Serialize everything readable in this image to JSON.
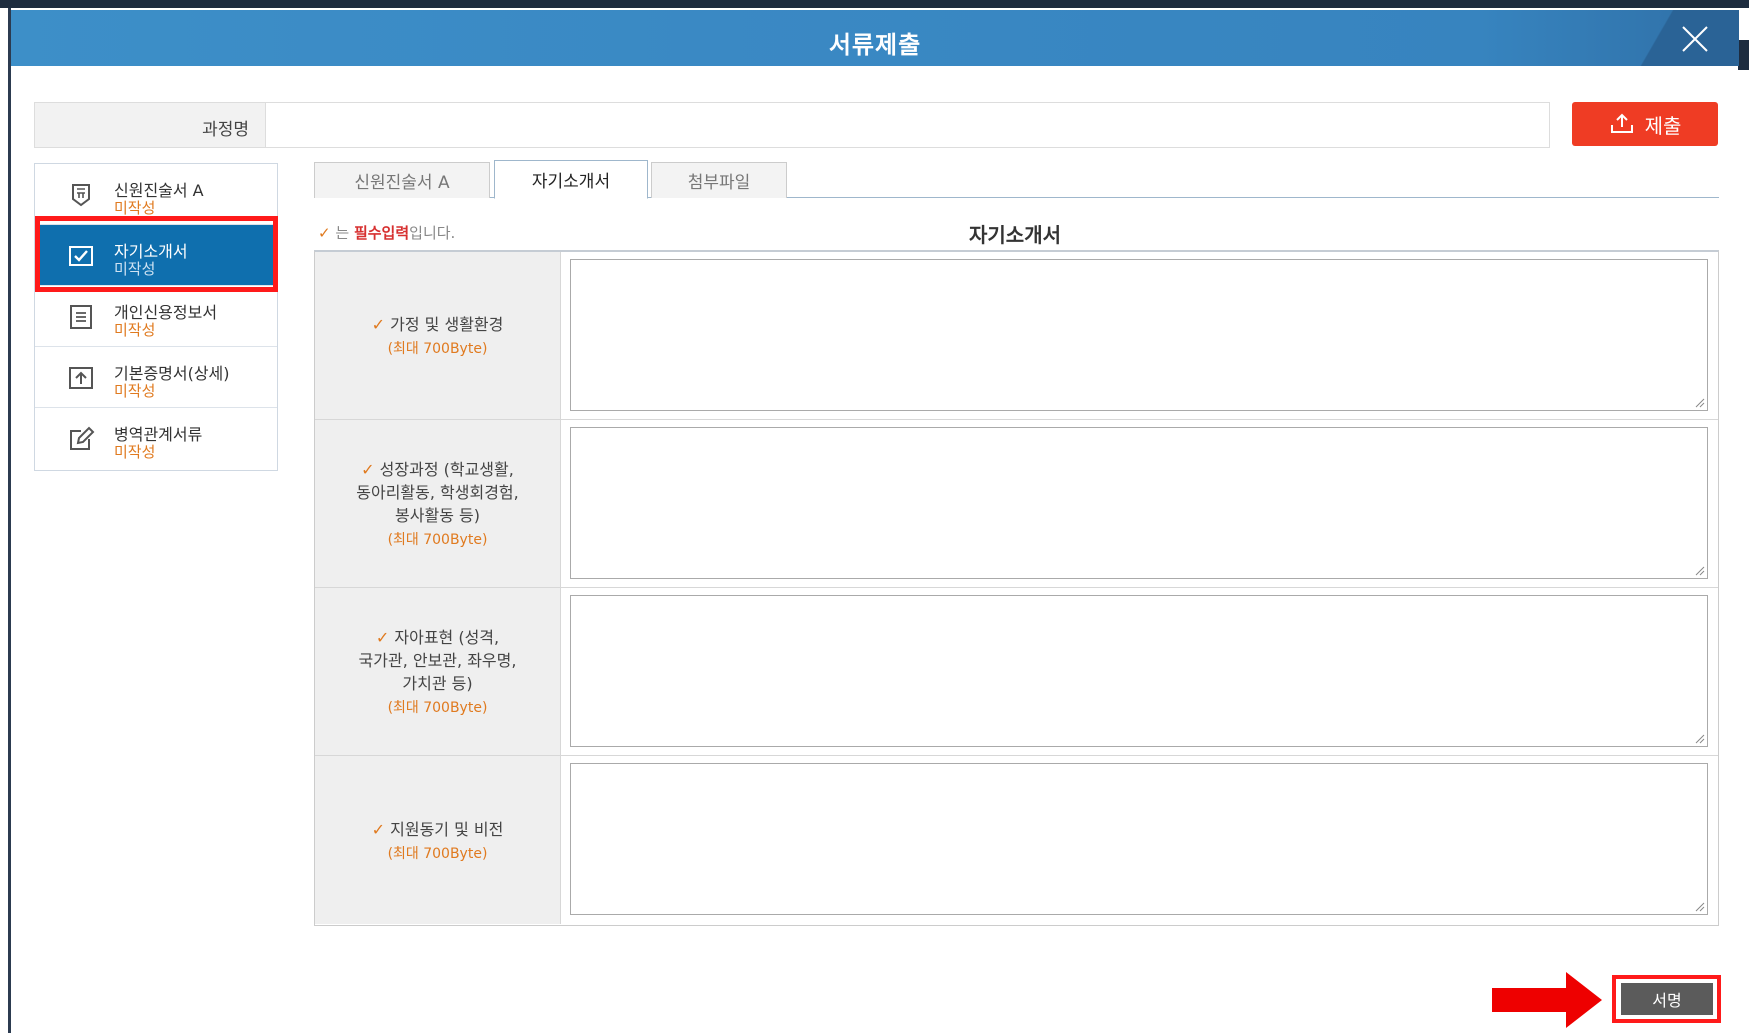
{
  "dialog": {
    "title": "서류제출",
    "close_icon": "close-icon"
  },
  "course": {
    "label": "과정명",
    "value": ""
  },
  "submit": {
    "label": "제출",
    "icon": "upload-icon",
    "color": "#ef3c24"
  },
  "sidebar": {
    "items": [
      {
        "name": "신원진술서 A",
        "status": "미작성",
        "icon": "badge-icon",
        "active": false
      },
      {
        "name": "자기소개서",
        "status": "미작성",
        "icon": "checkbox-icon",
        "active": true
      },
      {
        "name": "개인신용정보서",
        "status": "미작성",
        "icon": "document-icon",
        "active": false
      },
      {
        "name": "기본증명서(상세)",
        "status": "미작성",
        "icon": "upload-box-icon",
        "active": false
      },
      {
        "name": "병역관계서류",
        "status": "미작성",
        "icon": "edit-icon",
        "active": false
      }
    ],
    "active_color": "#0f6fae"
  },
  "tabs": [
    {
      "label": "신원진술서 A",
      "active": false
    },
    {
      "label": "자기소개서",
      "active": true
    },
    {
      "label": "첨부파일",
      "active": false
    }
  ],
  "required_note": {
    "check": "✓",
    "prefix": "는 ",
    "bold": "필수입력",
    "suffix": "입니다."
  },
  "form": {
    "title": "자기소개서",
    "fields": [
      {
        "label": "가정 및 생활환경",
        "limit": "(최대 700Byte)",
        "value": ""
      },
      {
        "label": "성장과정 (학교생활,\n동아리활동, 학생회경험,\n봉사활동 등)",
        "limit": "(최대 700Byte)",
        "value": ""
      },
      {
        "label": "자아표현 (성격,\n국가관, 안보관, 좌우명,\n가치관 등)",
        "limit": "(최대 700Byte)",
        "value": ""
      },
      {
        "label": "지원동기 및 비전",
        "limit": "(최대 700Byte)",
        "value": ""
      }
    ]
  },
  "sign": {
    "label": "서명"
  },
  "annotation": {
    "highlight_color": "#ff1a1a"
  }
}
